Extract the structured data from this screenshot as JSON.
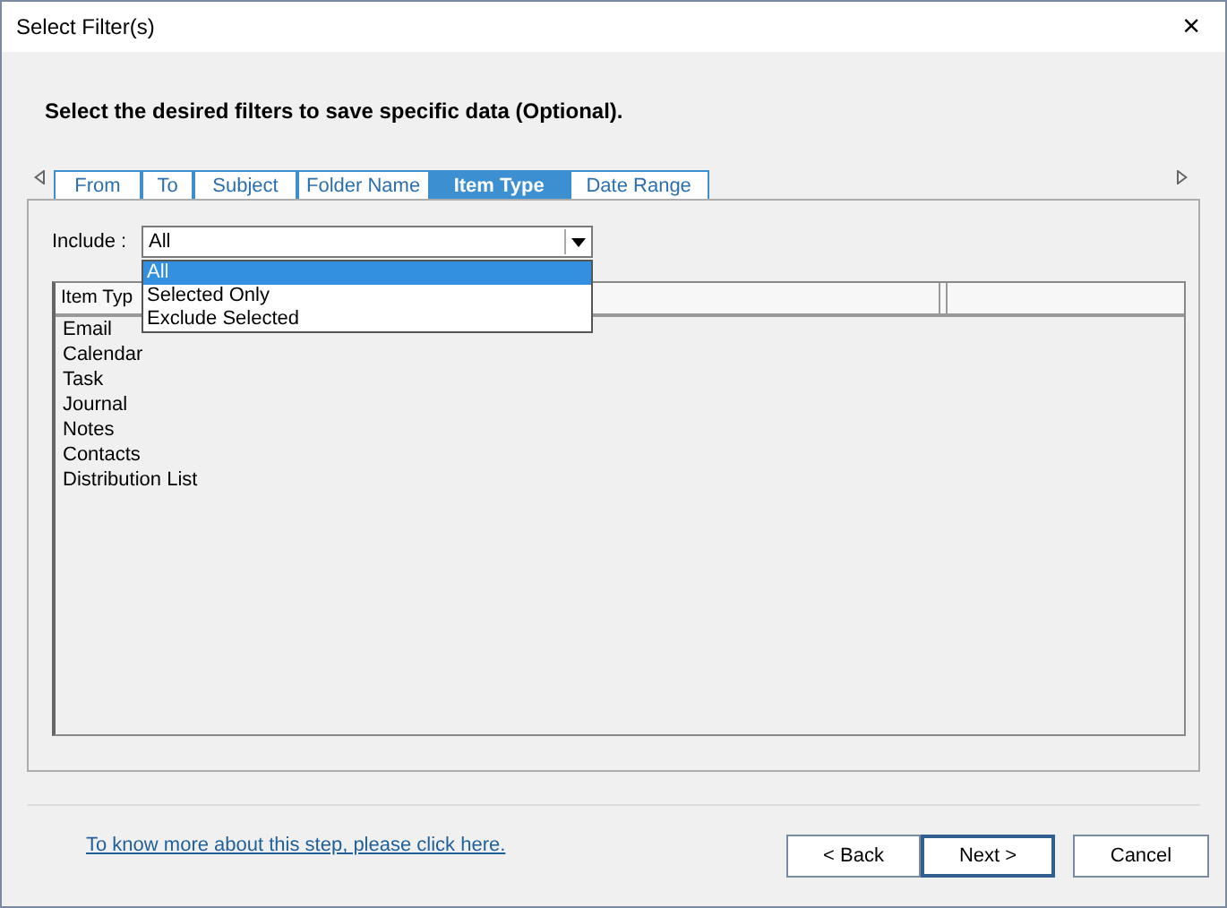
{
  "window": {
    "title": "Select Filter(s)",
    "close": "×"
  },
  "instruction": "Select the desired filters to save specific data (Optional).",
  "tabs": [
    {
      "label": "From",
      "selected": false
    },
    {
      "label": "To",
      "selected": false
    },
    {
      "label": "Subject",
      "selected": false
    },
    {
      "label": "Folder Name",
      "selected": false
    },
    {
      "label": "Item Type",
      "selected": true
    },
    {
      "label": "Date Range",
      "selected": false
    }
  ],
  "include": {
    "label": "Include :",
    "value": "All",
    "options": [
      {
        "label": "All",
        "selected": true
      },
      {
        "label": "Selected Only",
        "selected": false
      },
      {
        "label": "Exclude Selected",
        "selected": false
      }
    ]
  },
  "list": {
    "columns": [
      "Item Typ"
    ],
    "rows": [
      "Email",
      "Calendar",
      "Task",
      "Journal",
      "Notes",
      "Contacts",
      "Distribution List"
    ]
  },
  "help_link": "To know more about this step, please click here.",
  "buttons": [
    "< Back",
    "Next >",
    "Cancel"
  ]
}
